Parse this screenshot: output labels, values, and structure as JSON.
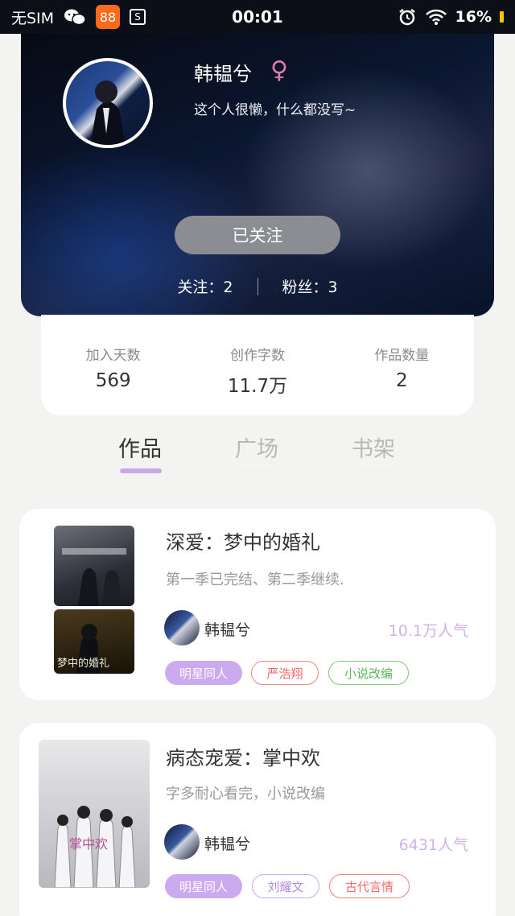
{
  "status_bar": {
    "carrier": "无SIM",
    "app_icon_glyph": "88",
    "s_icon_glyph": "S",
    "time": "00:01",
    "battery": "16%"
  },
  "profile": {
    "name": "韩韫兮",
    "gender_symbol": "♀",
    "bio": "这个人很懒，什么都没写~",
    "follow_button": "已关注",
    "following": "关注：2",
    "followers": "粉丝：3"
  },
  "stats": [
    {
      "label": "加入天数",
      "value": "569"
    },
    {
      "label": "创作字数",
      "value": "11.7万"
    },
    {
      "label": "作品数量",
      "value": "2"
    }
  ],
  "tabs": [
    {
      "label": "作品",
      "active": true
    },
    {
      "label": "广场",
      "active": false
    },
    {
      "label": "书架",
      "active": false
    }
  ],
  "works": [
    {
      "title": "深爱：梦中的婚礼",
      "description": "第一季已完结、第二季继续.",
      "author": "韩韫兮",
      "popularity": "10.1万人气",
      "cover_text": "梦中的婚礼",
      "tags": [
        {
          "label": "明星同人",
          "style": "filled"
        },
        {
          "label": "严浩翔",
          "style": "red"
        },
        {
          "label": "小说改编",
          "style": "green"
        }
      ]
    },
    {
      "title": "病态宠爱：掌中欢",
      "description": "字多耐心看完，小说改编",
      "author": "韩韫兮",
      "popularity": "6431人气",
      "cover_text": "掌中欢",
      "tags": [
        {
          "label": "明星同人",
          "style": "filled"
        },
        {
          "label": "刘耀文",
          "style": "purple"
        },
        {
          "label": "古代言情",
          "style": "red"
        }
      ]
    }
  ],
  "colors": {
    "accent": "#c9a8e8",
    "popularity": "#d1b2ea",
    "follow_button": "#8b8d92"
  }
}
